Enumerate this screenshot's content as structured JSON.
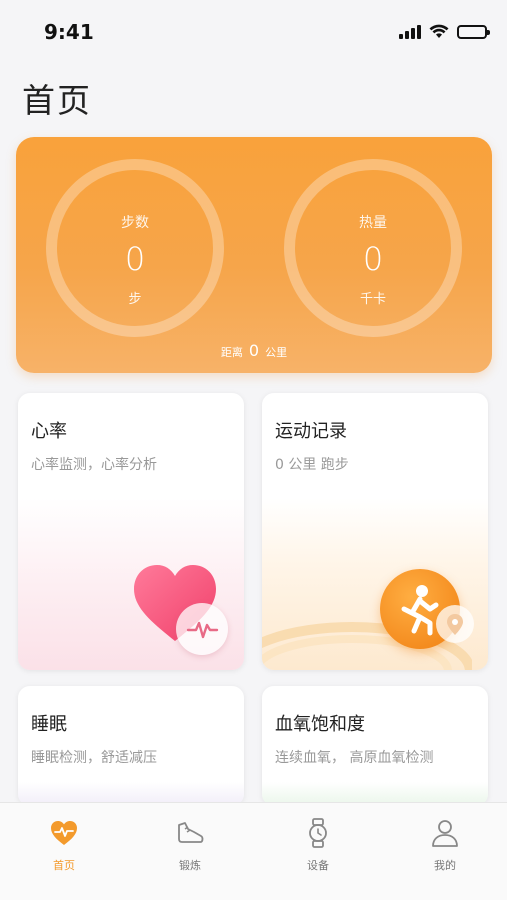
{
  "status_bar": {
    "time": "9:41"
  },
  "page": {
    "title": "首页"
  },
  "summary": {
    "steps": {
      "label": "步数",
      "value": "0",
      "unit": "步"
    },
    "calories": {
      "label": "热量",
      "value": "0",
      "unit": "千卡"
    },
    "distance": {
      "label": "距离",
      "value": "0",
      "unit": "公里"
    },
    "accent_color": "#f9a23b"
  },
  "cards": {
    "heart_rate": {
      "title": "心率",
      "subtitle": "心率监测，心率分析"
    },
    "exercise": {
      "title": "运动记录",
      "subtitle": "0 公里 跑步"
    },
    "sleep": {
      "title": "睡眠",
      "subtitle": "睡眠检测，舒适减压"
    },
    "spo2": {
      "title": "血氧饱和度",
      "subtitle": "连续血氧， 高原血氧检测"
    }
  },
  "tabbar": {
    "items": [
      {
        "label": "首页",
        "icon": "heart-pulse-icon",
        "active": true
      },
      {
        "label": "锻炼",
        "icon": "sneaker-icon",
        "active": false
      },
      {
        "label": "设备",
        "icon": "watch-icon",
        "active": false
      },
      {
        "label": "我的",
        "icon": "person-icon",
        "active": false
      }
    ],
    "active_color": "#f39a2c"
  }
}
